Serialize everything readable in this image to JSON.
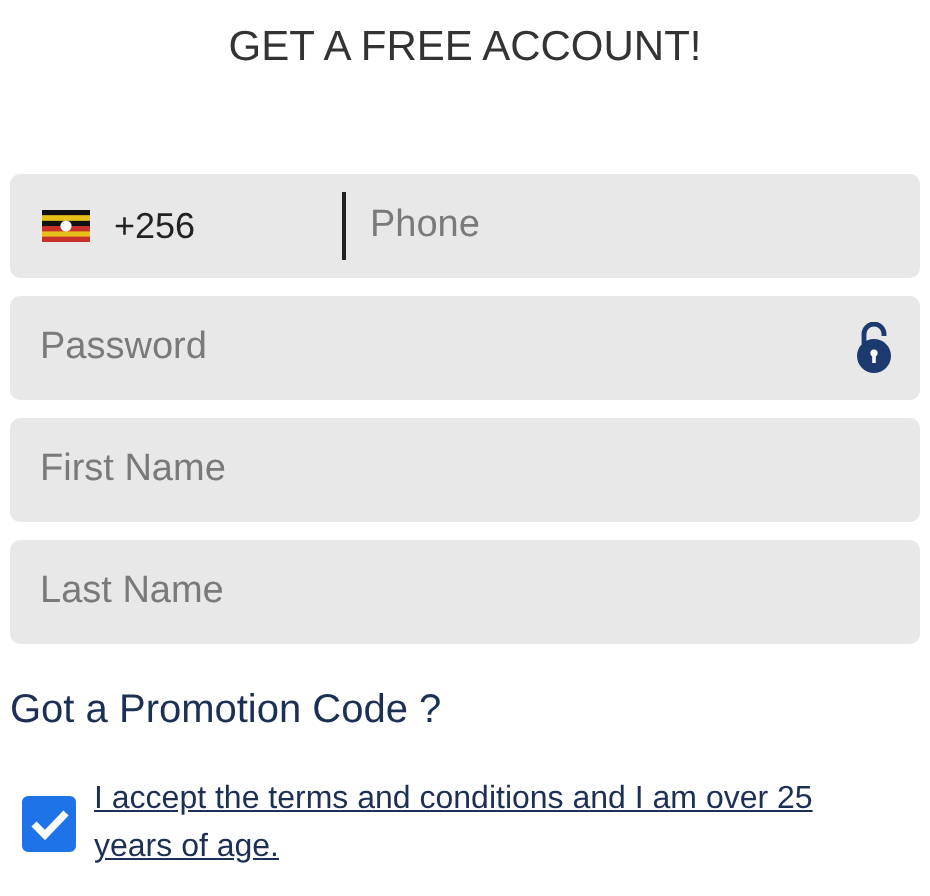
{
  "title": "GET A FREE ACCOUNT!",
  "fields": [
    {
      "kind": "phone",
      "dial_code": "+256",
      "placeholder": "Phone"
    },
    {
      "kind": "password",
      "placeholder": "Password"
    },
    {
      "kind": "text",
      "placeholder": "First Name"
    },
    {
      "kind": "text",
      "placeholder": "Last Name"
    }
  ],
  "promo_link": "Got a Promotion Code ?",
  "terms": {
    "checked": true,
    "text": "I accept the terms and conditions and I am over 25 years of age."
  }
}
